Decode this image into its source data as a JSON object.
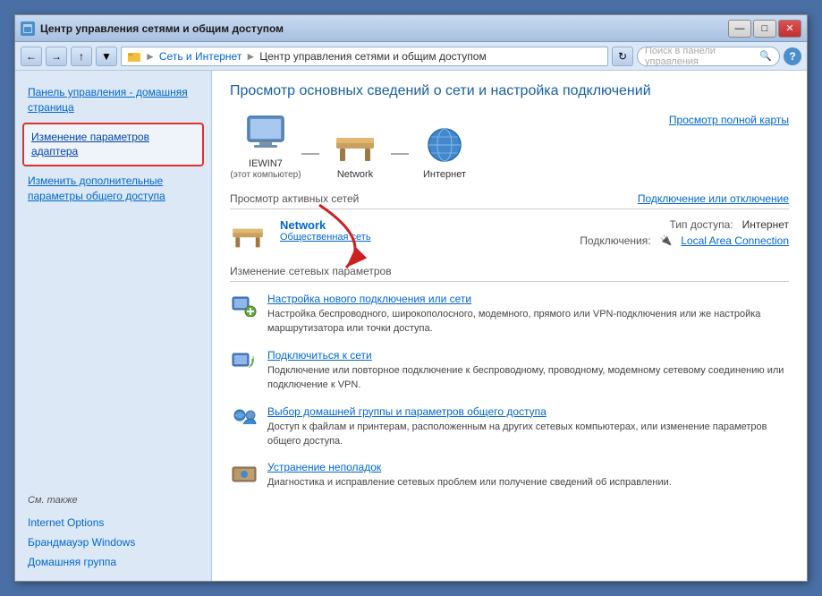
{
  "window": {
    "title": "Центр управления сетями и общим доступом",
    "controls": {
      "minimize": "—",
      "maximize": "□",
      "close": "✕"
    }
  },
  "addressBar": {
    "breadcrumbs": [
      "Сеть и Интернет",
      "Центр управления сетями и общим доступом"
    ],
    "searchPlaceholder": "Поиск в панели управления"
  },
  "sidebar": {
    "homeLabel": "Панель управления -\nдомашняя страница",
    "items": [
      {
        "id": "change-adapter",
        "label": "Изменение параметров адаптера",
        "highlighted": true
      },
      {
        "id": "change-advanced",
        "label": "Изменить дополнительные параметры общего доступа",
        "highlighted": false
      }
    ],
    "seeAlso": "См. также",
    "footerItems": [
      {
        "id": "internet-options",
        "label": "Internet Options"
      },
      {
        "id": "firewall",
        "label": "Брандмауэр Windows"
      },
      {
        "id": "homegroup",
        "label": "Домашняя группа"
      }
    ]
  },
  "content": {
    "pageTitle": "Просмотр основных сведений о сети и настройка подключений",
    "viewFullMap": "Просмотр полной карты",
    "networkMap": {
      "nodes": [
        {
          "id": "computer",
          "label": "IEWIN7\n(этот компьютер)",
          "type": "monitor"
        },
        {
          "id": "network",
          "label": "Network",
          "type": "bench"
        },
        {
          "id": "internet",
          "label": "Интернет",
          "type": "globe"
        }
      ]
    },
    "activeNetworksSection": {
      "title": "Просмотр активных сетей",
      "actionLabel": "Подключение или отключение",
      "network": {
        "name": "Network",
        "type": "Общественная сеть",
        "accessType": "Интернет",
        "accessLabel": "Тип доступа:",
        "connectionLabel": "Подключения:",
        "connectionValue": "Local Area Connection",
        "connectionIcon": "🔌"
      }
    },
    "changeSection": {
      "title": "Изменение сетевых параметров",
      "items": [
        {
          "id": "new-connection",
          "link": "Настройка нового подключения или сети",
          "desc": "Настройка беспроводного, широкополосного, модемного, прямого или VPN-подключения или же настройка маршрутизатора или точки доступа."
        },
        {
          "id": "connect-to-network",
          "link": "Подключиться к сети",
          "desc": "Подключение или повторное подключение к беспроводному, проводному, модемному сетевому соединению или подключение к VPN."
        },
        {
          "id": "homegroup-sharing",
          "link": "Выбор домашней группы и параметров общего доступа",
          "desc": "Доступ к файлам и принтерам, расположенным на других сетевых компьютерах, или изменение параметров общего доступа."
        },
        {
          "id": "troubleshoot",
          "link": "Устранение неполадок",
          "desc": "Диагностика и исправление сетевых проблем или получение сведений об исправлении."
        }
      ]
    }
  }
}
